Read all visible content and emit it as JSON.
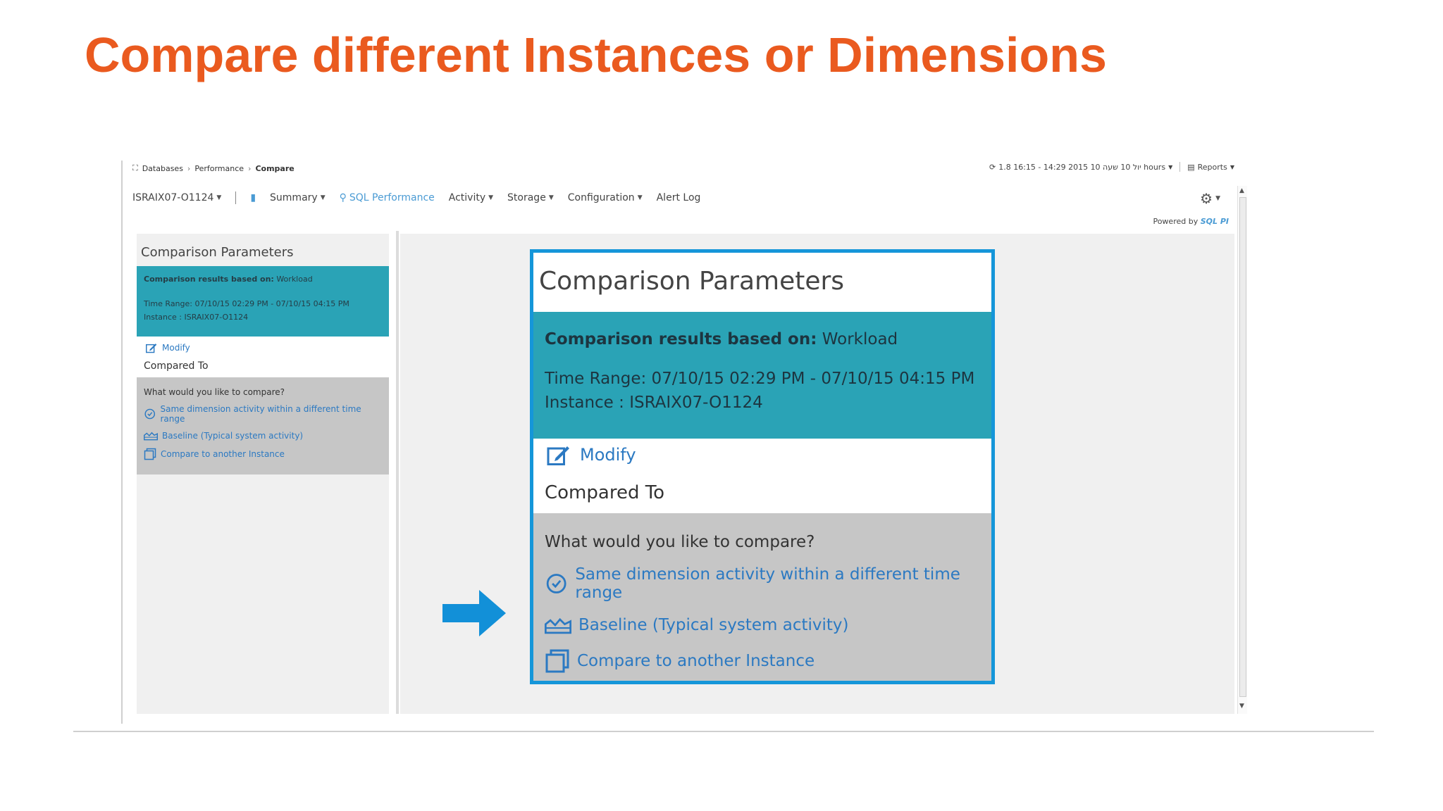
{
  "slide": {
    "title": "Compare different Instances or Dimensions"
  },
  "colors": {
    "title": "#ea5a1f",
    "teal": "#2aa3b6",
    "link": "#2b79c2",
    "highlight_border": "#1596d9",
    "arrow": "#1290d8"
  },
  "breadcrumb": {
    "items": [
      "Databases",
      "Performance",
      "Compare"
    ]
  },
  "time_range_bar": {
    "text": "1.8 16:15 - 14:29 2015 יול 10 שעה 10 hours",
    "reports_label": "Reports"
  },
  "nav": {
    "instance": "ISRAIX07-O1124",
    "items": [
      "Summary",
      "SQL Performance",
      "Activity",
      "Storage",
      "Configuration",
      "Alert Log"
    ]
  },
  "powered": {
    "label": "Powered by",
    "brand": "SQL PI"
  },
  "panel": {
    "title": "Comparison Parameters",
    "based_on_label": "Comparison results based on:",
    "based_on_value": "Workload",
    "time_range": "Time Range: 07/10/15 02:29 PM - 07/10/15 04:15 PM",
    "instance": "Instance : ISRAIX07-O1124",
    "modify": "Modify",
    "compared_to": "Compared To",
    "question": "What would you like to compare?",
    "options": [
      {
        "label": "Same dimension activity within a different time range",
        "icon": "clock-refresh-icon"
      },
      {
        "label": "Baseline (Typical system activity)",
        "icon": "baseline-chart-icon"
      },
      {
        "label": "Compare to another Instance",
        "icon": "instances-icon"
      }
    ]
  }
}
